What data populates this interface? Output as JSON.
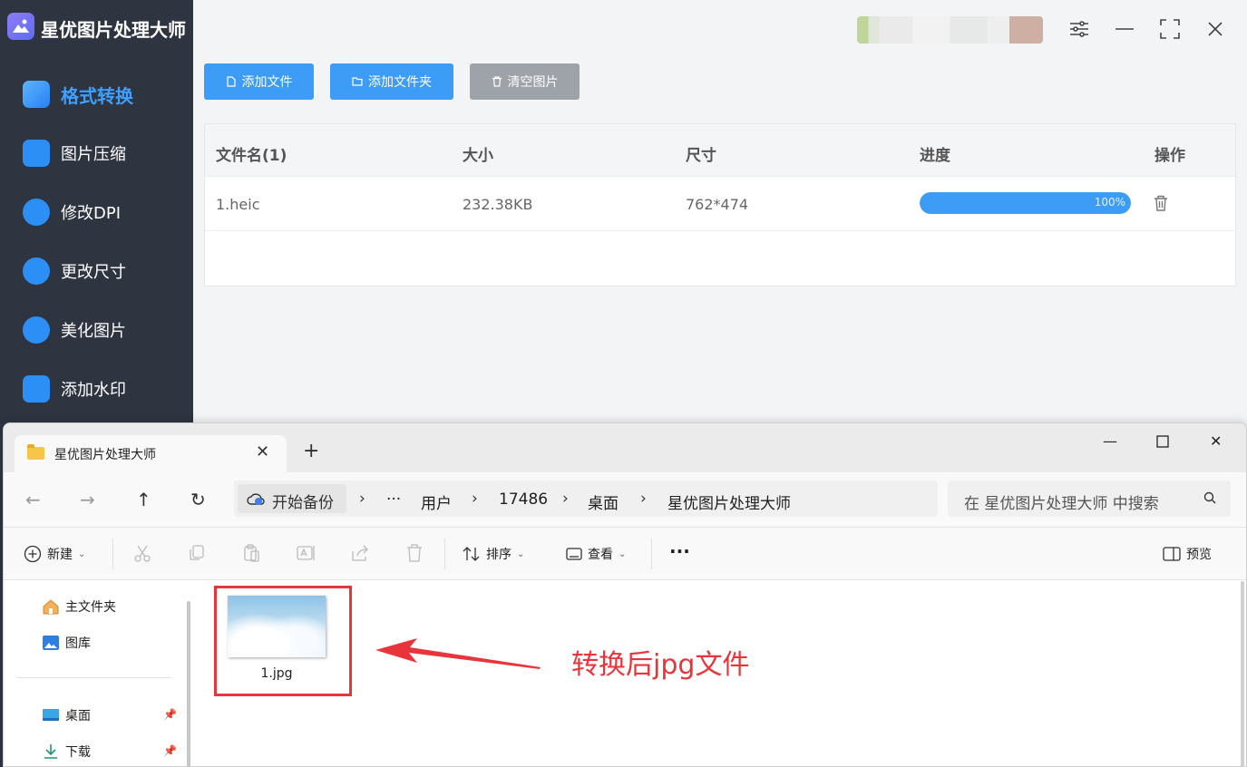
{
  "app": {
    "title": "星优图片处理大师",
    "nav": [
      {
        "label": "格式转换",
        "icon": "image-convert-icon",
        "active": true
      },
      {
        "label": "图片压缩",
        "icon": "image-compress-icon"
      },
      {
        "label": "修改DPI",
        "icon": "dpi-icon"
      },
      {
        "label": "更改尺寸",
        "icon": "resize-icon"
      },
      {
        "label": "美化图片",
        "icon": "beautify-icon"
      },
      {
        "label": "添加水印",
        "icon": "watermark-icon"
      }
    ],
    "toolbar": {
      "add_file": "添加文件",
      "add_folder": "添加文件夹",
      "clear": "清空图片"
    },
    "table": {
      "headers": {
        "name": "文件名(1)",
        "size": "大小",
        "dimension": "尺寸",
        "progress": "进度",
        "action": "操作"
      },
      "rows": [
        {
          "name": "1.heic",
          "size": "232.38KB",
          "dimension": "762*474",
          "progress": 1.0,
          "progress_text": "100%"
        }
      ]
    },
    "colors": {
      "sidebar": "#2f3441",
      "accent": "#3d9cf5",
      "active_nav": "#3ea0ff"
    }
  },
  "explorer": {
    "tab_title": "星优图片处理大师",
    "breadcrumb": {
      "home": "开始备份",
      "ellipsis": "···",
      "items": [
        "用户",
        "17486",
        "桌面",
        "星优图片处理大师"
      ]
    },
    "search_placeholder": "在 星优图片处理大师 中搜索",
    "commands": {
      "new": "新建",
      "sort": "排序",
      "view": "查看",
      "more": "···",
      "preview": "预览"
    },
    "nav_pane": {
      "home": "主文件夹",
      "gallery": "图库",
      "desktop": "桌面",
      "downloads": "下载"
    },
    "files": [
      {
        "name": "1.jpg"
      }
    ]
  },
  "annotation": {
    "text": "转换后jpg文件",
    "color": "#e8353b"
  }
}
